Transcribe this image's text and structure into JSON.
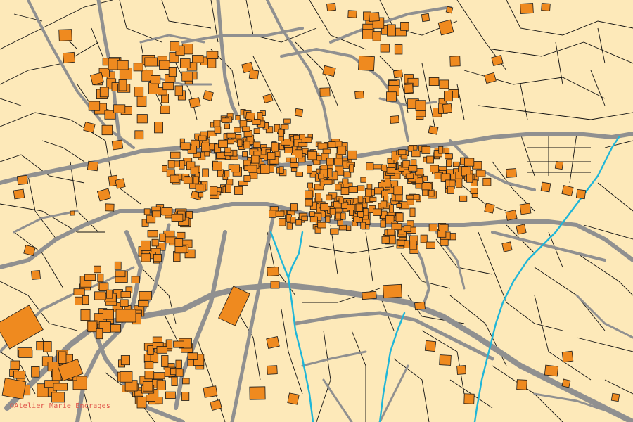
{
  "map": {
    "attribution": "©Atelier Marie Encrages"
  },
  "legend_colors": {
    "background": "#fde9b9",
    "building_fill": "#ef8a1f",
    "road": "#909090",
    "parcel_line": "#111111",
    "stream": "#1fb6d8",
    "attribution_text": "#e0554a"
  },
  "features": {
    "layers": [
      "parcels",
      "roads",
      "streams",
      "buildings"
    ],
    "dense_town_center": true,
    "scattered_buildings": true,
    "stream_count": 4
  }
}
